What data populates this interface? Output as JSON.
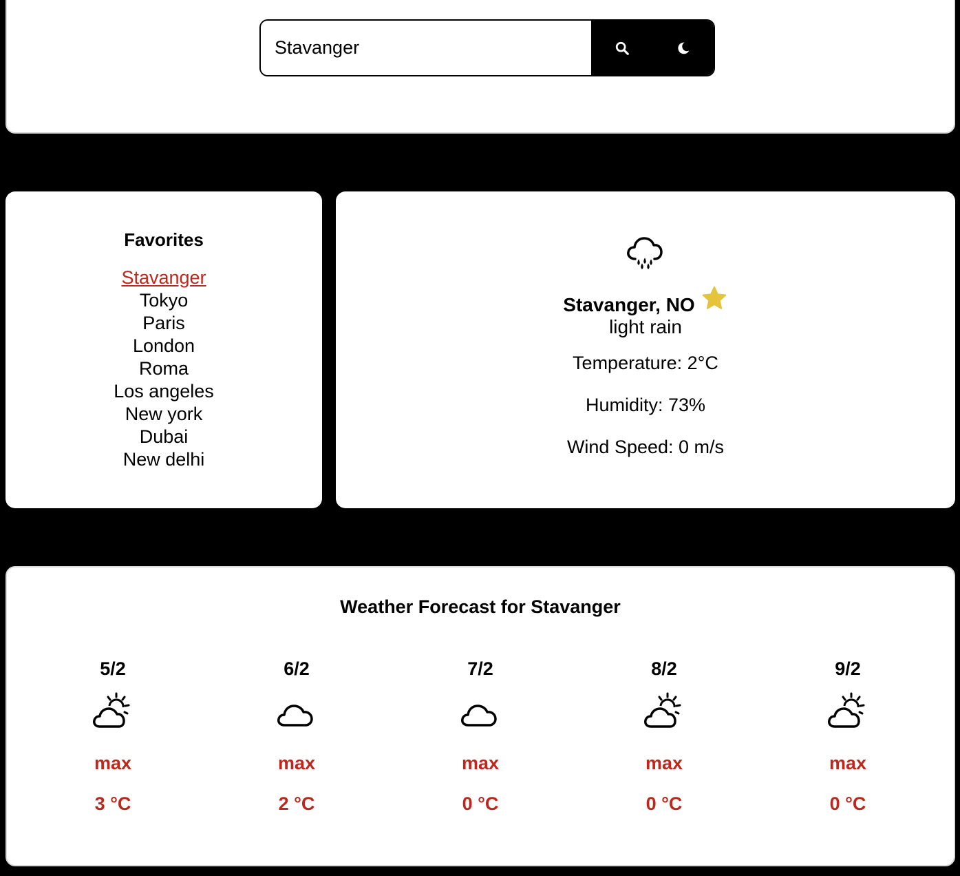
{
  "search": {
    "value": "Stavanger",
    "search_icon": "search-icon",
    "theme_icon": "moon-icon"
  },
  "favorites": {
    "title": "Favorites",
    "items": [
      {
        "label": "Stavanger",
        "active": true
      },
      {
        "label": "Tokyo",
        "active": false
      },
      {
        "label": "Paris",
        "active": false
      },
      {
        "label": "London",
        "active": false
      },
      {
        "label": "Roma",
        "active": false
      },
      {
        "label": "Los angeles",
        "active": false
      },
      {
        "label": "New york",
        "active": false
      },
      {
        "label": "Dubai",
        "active": false
      },
      {
        "label": "New delhi",
        "active": false
      }
    ]
  },
  "current": {
    "icon": "rain-cloud-icon",
    "city": "Stavanger, NO",
    "favorite_icon": "star-icon",
    "description": "light rain",
    "temperature": "Temperature: 2°C",
    "humidity": "Humidity: 73%",
    "wind": "Wind Speed: 0 m/s"
  },
  "forecast": {
    "title": "Weather Forecast for Stavanger",
    "days": [
      {
        "date": "5/2",
        "icon": "partly-cloudy-icon",
        "max_label": "max",
        "temp": "3 °C"
      },
      {
        "date": "6/2",
        "icon": "cloud-icon",
        "max_label": "max",
        "temp": "2 °C"
      },
      {
        "date": "7/2",
        "icon": "cloud-icon",
        "max_label": "max",
        "temp": "0 °C"
      },
      {
        "date": "8/2",
        "icon": "partly-cloudy-icon",
        "max_label": "max",
        "temp": "0 °C"
      },
      {
        "date": "9/2",
        "icon": "partly-cloudy-icon",
        "max_label": "max",
        "temp": "0 °C"
      }
    ]
  },
  "colors": {
    "accent_red": "#c0271c",
    "star_yellow": "#e5c33a",
    "background": "#000000"
  }
}
